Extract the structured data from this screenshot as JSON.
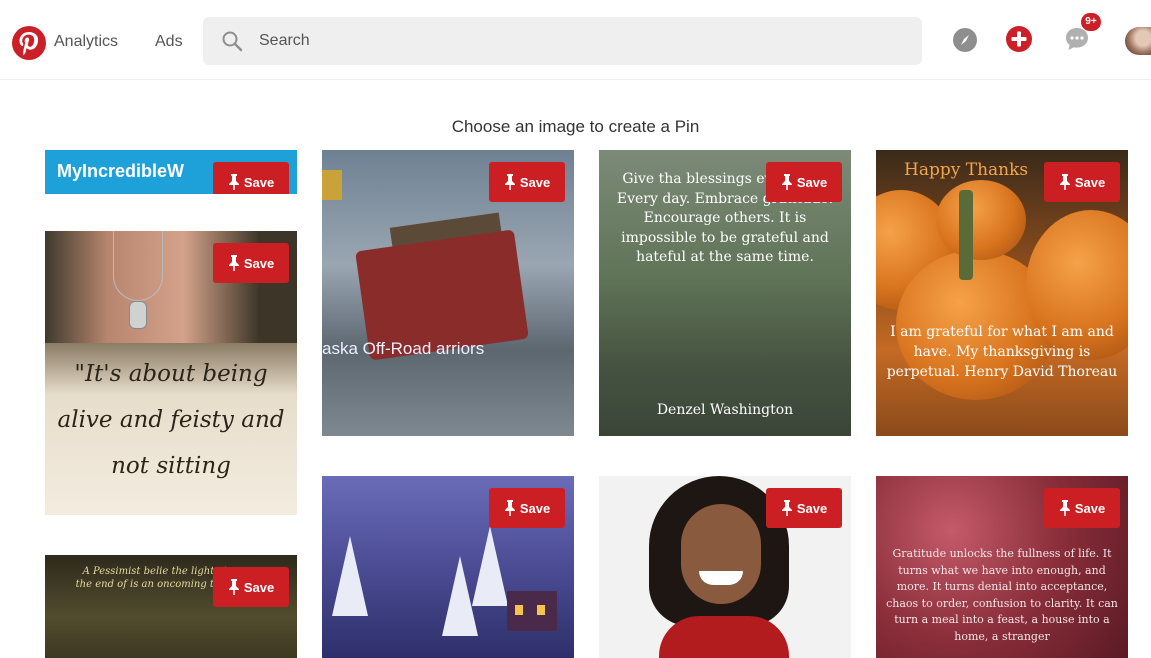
{
  "header": {
    "nav": {
      "analytics": "Analytics",
      "ads": "Ads"
    },
    "search": {
      "placeholder": "Search"
    },
    "notifications_badge": "9+"
  },
  "page": {
    "title": "Choose an image to create a Pin"
  },
  "save_label": "Save",
  "pins": [
    {
      "text": "MyIncredibleW"
    },
    {
      "text": "\"It's about being alive and feisty and not sitting"
    },
    {
      "text": "A Pessimist belie the light at the end of is an oncoming train"
    },
    {
      "text": "aska Off-Road arriors"
    },
    {
      "text": ""
    },
    {
      "text": "Give tha blessings every day. Every day. Embrace gratitude. Encourage others. It is impossible to be grateful and hateful at the same time.",
      "author": "Denzel Washington"
    },
    {
      "text": ""
    },
    {
      "headline": "Happy Thanks",
      "text": "I am grateful for what I am and have. My thanksgiving is perpetual. Henry David Thoreau"
    },
    {
      "text": "Gratitude unlocks the fullness of life. It turns what we have into enough, and more. It turns denial into acceptance, chaos to order, confusion to clarity. It can turn a meal into a feast, a house into a home, a stranger"
    }
  ],
  "colors": {
    "brand_red": "#cb2027",
    "save_red": "#cb1f24",
    "header_banner_blue": "#1ea1d9"
  }
}
